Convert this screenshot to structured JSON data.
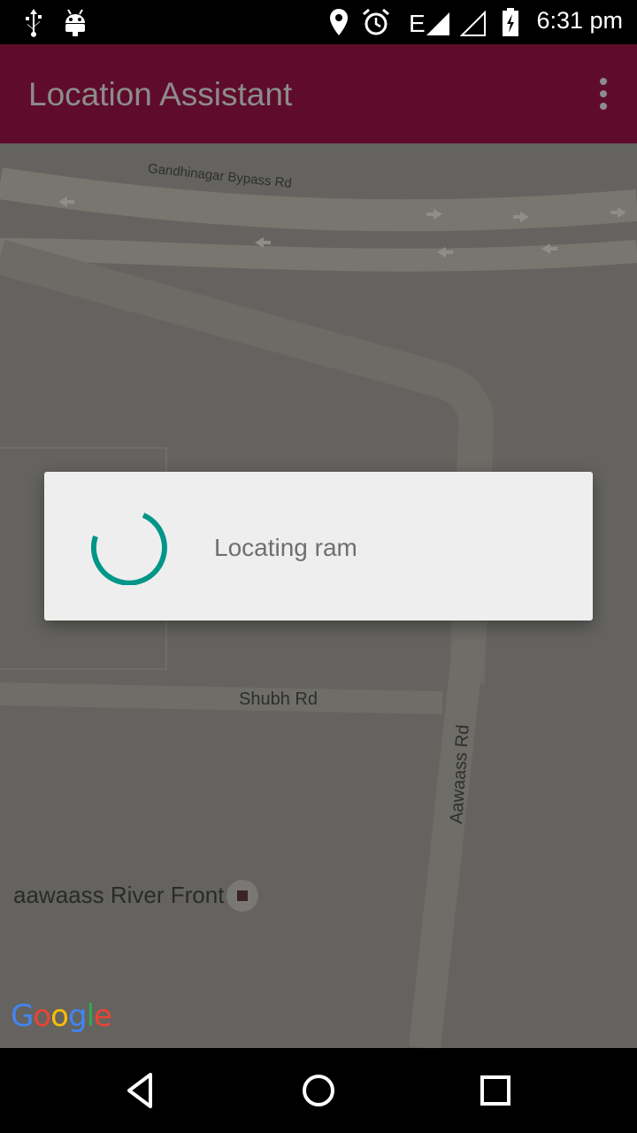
{
  "status_bar": {
    "time": "6:31 pm",
    "icons": [
      "usb-icon",
      "android-debug-icon",
      "location-icon",
      "alarm-icon",
      "network-e-icon",
      "signal-icon",
      "signal-empty-icon",
      "battery-charging-icon"
    ]
  },
  "app_bar": {
    "title": "Location Assistant",
    "menu_icon": "overflow-menu-icon"
  },
  "map": {
    "road_labels": {
      "bypass": "Gandhinagar Bypass Rd",
      "shubh": "Shubh Rd",
      "aawaass": "Aawaass Rd"
    },
    "poi_label": "aawaass River Front",
    "logo": [
      "G",
      "o",
      "o",
      "g",
      "l",
      "e"
    ],
    "logo_colors": [
      "#4285f4",
      "#ea4335",
      "#fbbc05",
      "#4285f4",
      "#34a853",
      "#ea4335"
    ]
  },
  "dialog": {
    "message": "Locating ram",
    "spinner_color": "#009688"
  },
  "nav_bar": {
    "icons": [
      "back-icon",
      "home-icon",
      "recents-icon"
    ]
  }
}
